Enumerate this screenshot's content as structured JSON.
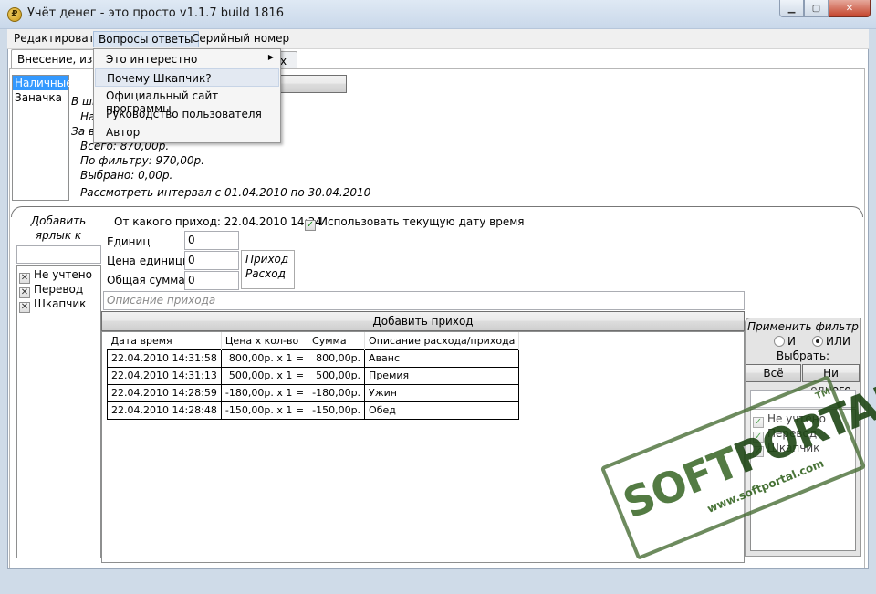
{
  "window": {
    "title": "Учёт денег - это просто v1.1.7 build 1816"
  },
  "menu": {
    "items": [
      "Редактировать",
      "Вопросы ответы",
      "Серийный номер"
    ]
  },
  "dropdown": {
    "items": [
      "Это интерестно",
      "Почему Шкапчик?",
      "Официальный сайт программы",
      "Руководство пользователя",
      "Автор"
    ]
  },
  "tabs": {
    "active": "Внесение, измен",
    "second_fragment": "х"
  },
  "accounts": [
    "Наличные",
    "Заначка"
  ],
  "summary": {
    "line1": "В шк",
    "line2": "На",
    "line3": "За вы",
    "total": "Всего: 870,00р.",
    "filtered": "По фильтру: 970,00р.",
    "selected": "Выбрано: 0,00р.",
    "interval": "Рассмотреть интервал с  01.04.2010  по  30.04.2010"
  },
  "entry": {
    "tag_label": "Добавить ярлык к приходу",
    "from_when_label": "От какого приход: 22.04.2010  14:34",
    "use_current_label": "Использовать текущую дату время",
    "units_label": "Единиц",
    "units_value": "0",
    "price_label": "Цена единицы",
    "price_value": "0",
    "sum_label": "Общая сумма",
    "sum_value": "0",
    "type_options": [
      "Приход",
      "Расход"
    ],
    "description_placeholder": "Описание прихода",
    "add_button": "Добавить приход"
  },
  "tags": [
    "Не учтено",
    "Перевод",
    "Шкапчик"
  ],
  "table": {
    "headers": [
      "Дата время",
      "Цена х кол-во",
      "Сумма",
      "Описание расхода/прихода"
    ],
    "rows": [
      [
        "22.04.2010 14:31:58",
        "800,00р. x 1  =",
        "800,00р.",
        "Аванс"
      ],
      [
        "22.04.2010 14:31:13",
        "500,00р. x 1  =",
        "500,00р.",
        "Премия"
      ],
      [
        "22.04.2010 14:28:59",
        "-180,00р. x 1  =",
        "-180,00р.",
        "Ужин"
      ],
      [
        "22.04.2010 14:28:48",
        "-150,00р. x 1  =",
        "-150,00р.",
        "Обед"
      ]
    ]
  },
  "filter": {
    "title": "Применить фильтр",
    "and": "И",
    "or": "ИЛИ",
    "choose": "Выбрать:",
    "all": "Всё",
    "none": "Ни одного",
    "items": [
      "Не учтено",
      "Перевод",
      "Шкапчик"
    ]
  },
  "watermark": {
    "brand_left": "SOFT",
    "brand_right": "PORTAL",
    "tm": "TM",
    "url": "www.softportal.com"
  }
}
